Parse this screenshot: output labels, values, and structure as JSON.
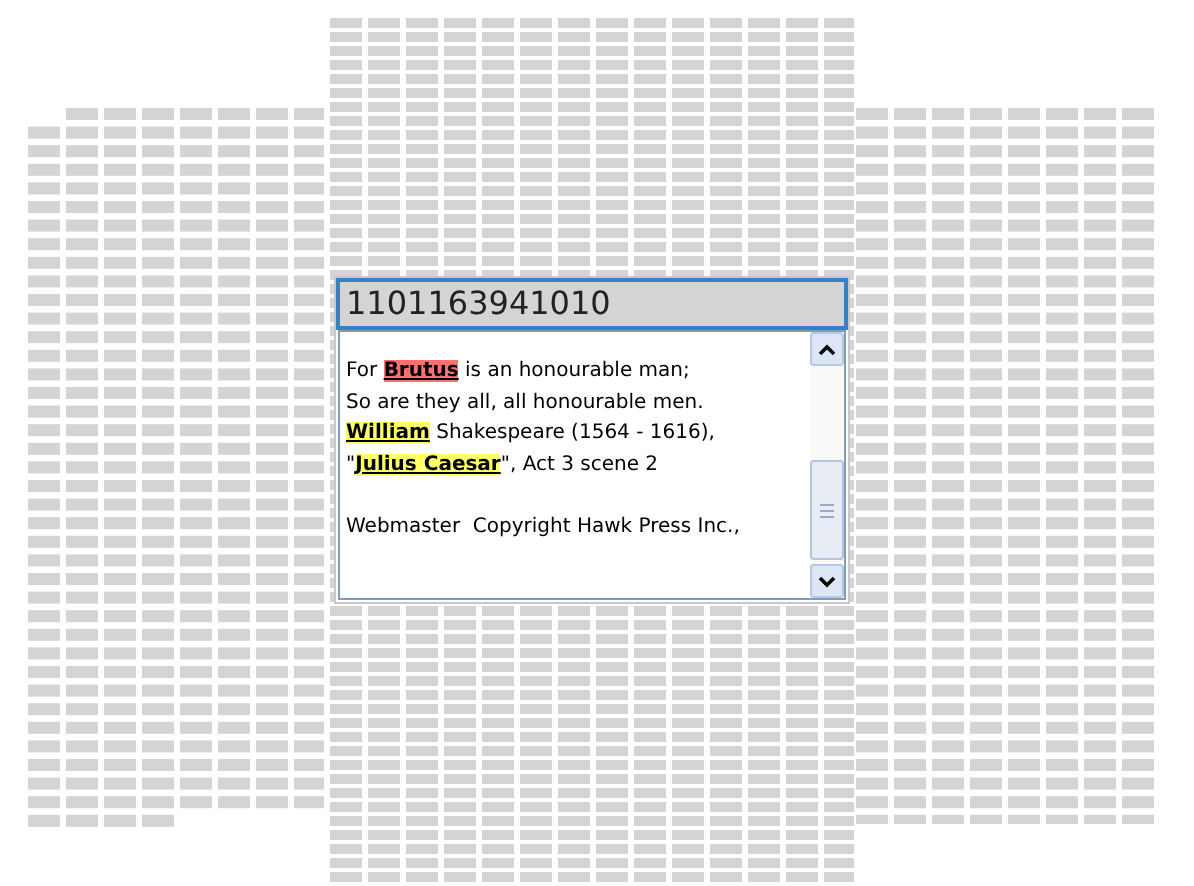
{
  "header": {
    "value": "1101163941010"
  },
  "lines": [
    {
      "segments": [
        {
          "text": "For "
        },
        {
          "text": "Brutus",
          "color": "#ff7070"
        },
        {
          "text": " is an honourable man;"
        }
      ]
    },
    {
      "segments": [
        {
          "text": "So are they all, all honourable men."
        }
      ]
    },
    {
      "segments": [
        {
          "text": "William",
          "color": "#ffff66"
        },
        {
          "text": " Shakespeare (1564 - 1616),"
        }
      ]
    },
    {
      "segments": [
        {
          "text": "\""
        },
        {
          "text": "Julius Caesar",
          "color": "#ffff66"
        },
        {
          "text": "\", Act 3 scene 2"
        }
      ]
    },
    {
      "segments": [
        {
          "text": "Webmaster  Copyright Hawk Press Inc.,"
        }
      ],
      "spaced": true
    }
  ]
}
